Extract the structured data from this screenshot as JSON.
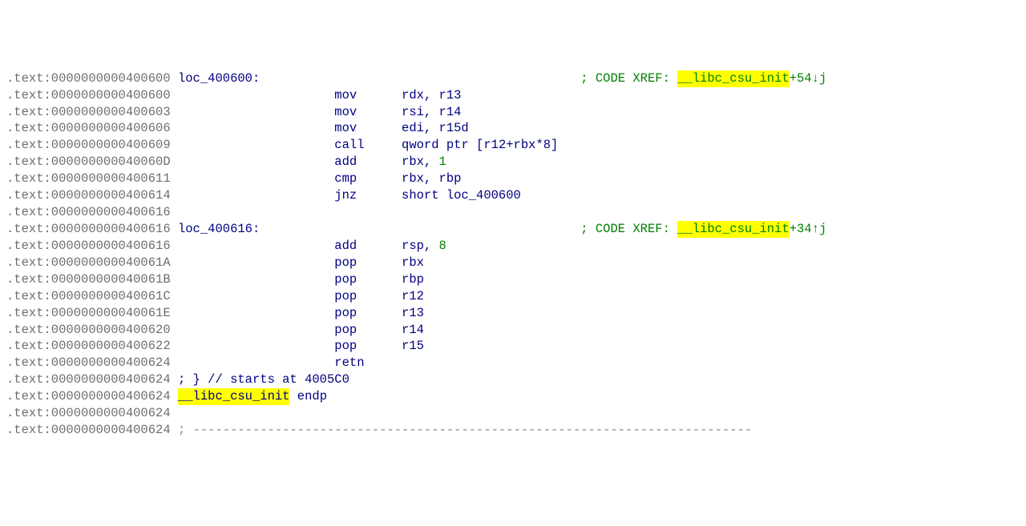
{
  "xref_prefix": "; CODE XREF: ",
  "lines": [
    {
      "addr": ".text:0000000000400600",
      "type": "instr",
      "label": "loc_400600:",
      "xref_link": "__libc_csu_init",
      "xref_tail": "+54↓j"
    },
    {
      "addr": ".text:0000000000400600",
      "type": "instr",
      "mnem": "mov",
      "ops": "rdx, r13"
    },
    {
      "addr": ".text:0000000000400603",
      "type": "instr",
      "mnem": "mov",
      "ops": "rsi, r14"
    },
    {
      "addr": ".text:0000000000400606",
      "type": "instr",
      "mnem": "mov",
      "ops": "edi, r15d"
    },
    {
      "addr": ".text:0000000000400609",
      "type": "instr",
      "mnem": "call",
      "ops": "qword ptr [r12+rbx*8]"
    },
    {
      "addr": ".text:000000000040060D",
      "type": "instr",
      "mnem": "add",
      "ops_pre": "rbx, ",
      "num": "1"
    },
    {
      "addr": ".text:0000000000400611",
      "type": "instr",
      "mnem": "cmp",
      "ops": "rbx, rbp"
    },
    {
      "addr": ".text:0000000000400614",
      "type": "instr",
      "mnem": "jnz",
      "ops": "short loc_400600"
    },
    {
      "addr": ".text:0000000000400616",
      "type": "blank"
    },
    {
      "addr": ".text:0000000000400616",
      "type": "instr",
      "label": "loc_400616:",
      "xref_link": "__libc_csu_init",
      "xref_tail": "+34↑j"
    },
    {
      "addr": ".text:0000000000400616",
      "type": "instr",
      "mnem": "add",
      "ops_pre": "rsp, ",
      "num": "8"
    },
    {
      "addr": ".text:000000000040061A",
      "type": "instr",
      "mnem": "pop",
      "ops": "rbx"
    },
    {
      "addr": ".text:000000000040061B",
      "type": "instr",
      "mnem": "pop",
      "ops": "rbp"
    },
    {
      "addr": ".text:000000000040061C",
      "type": "instr",
      "mnem": "pop",
      "ops": "r12"
    },
    {
      "addr": ".text:000000000040061E",
      "type": "instr",
      "mnem": "pop",
      "ops": "r13"
    },
    {
      "addr": ".text:0000000000400620",
      "type": "instr",
      "mnem": "pop",
      "ops": "r14"
    },
    {
      "addr": ".text:0000000000400622",
      "type": "instr",
      "mnem": "pop",
      "ops": "r15"
    },
    {
      "addr": ".text:0000000000400624",
      "type": "instr",
      "mnem": "retn",
      "ops": ""
    },
    {
      "addr": ".text:0000000000400624",
      "type": "comment",
      "text": "; } // starts at 4005C0"
    },
    {
      "addr": ".text:0000000000400624",
      "type": "endp",
      "hl": "__libc_csu_init",
      "after": " endp"
    },
    {
      "addr": ".text:0000000000400624",
      "type": "blank"
    },
    {
      "addr": ".text:0000000000400624",
      "type": "sep"
    }
  ]
}
